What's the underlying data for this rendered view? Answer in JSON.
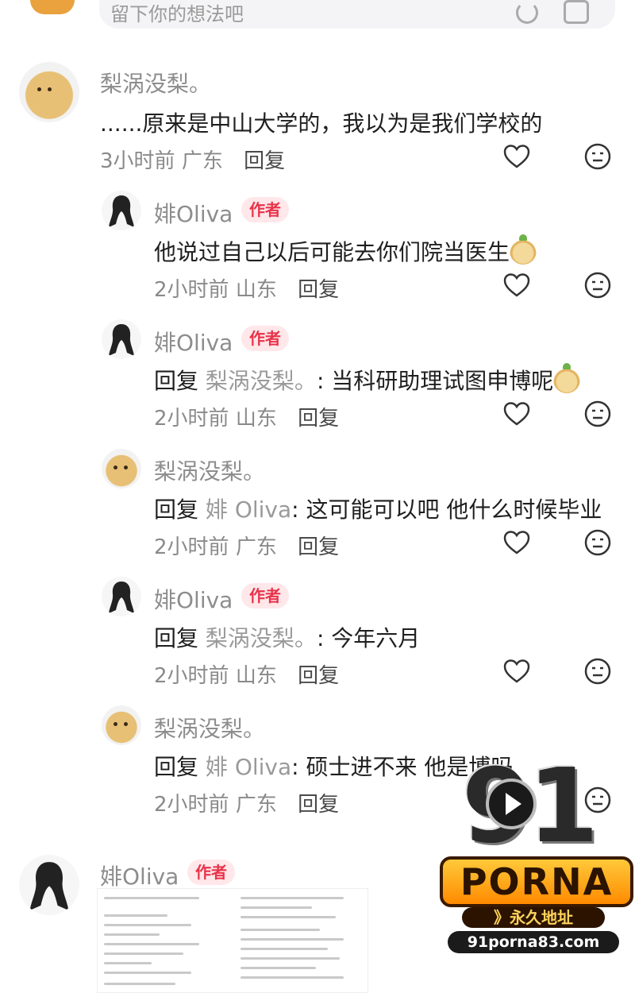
{
  "top_input": {
    "placeholder": "留下你的想法吧"
  },
  "comments": [
    {
      "id": "c1",
      "author": "梨涡没梨。",
      "text": "......原来是中山大学的，我以为是我们学校的",
      "time": "3小时前",
      "region": "广东",
      "reply_label": "回复",
      "avatar": "potato-avatar"
    },
    {
      "id": "r1",
      "author": "婔Oliva",
      "badge": "作者",
      "text": "他说过自己以后可能去你们院当医生",
      "emoji": "pear-emoji",
      "time": "2小时前",
      "region": "山东",
      "reply_label": "回复",
      "avatar": "girl-avatar"
    },
    {
      "id": "r2",
      "author": "婔Oliva",
      "badge": "作者",
      "reply_prefix": "回复",
      "reply_to": "梨涡没梨。",
      "text": ": 当科研助理试图申博呢",
      "emoji": "pear-emoji",
      "time": "2小时前",
      "region": "山东",
      "reply_label": "回复",
      "avatar": "girl-avatar"
    },
    {
      "id": "r3",
      "author": "梨涡没梨。",
      "reply_prefix": "回复",
      "reply_to": "婔 Oliva",
      "text": ": 这可能可以吧  他什么时候毕业",
      "time": "2小时前",
      "region": "广东",
      "reply_label": "回复",
      "avatar": "potato-avatar"
    },
    {
      "id": "r4",
      "author": "婔Oliva",
      "badge": "作者",
      "reply_prefix": "回复",
      "reply_to": "梨涡没梨。",
      "text": ": 今年六月",
      "time": "2小时前",
      "region": "山东",
      "reply_label": "回复",
      "avatar": "girl-avatar"
    },
    {
      "id": "r5",
      "author": "梨涡没梨。",
      "reply_prefix": "回复",
      "reply_to": "婔 Oliva",
      "text": ": 硕士进不来 他是博吗",
      "time": "2小时前",
      "region": "广东",
      "reply_label": "回复",
      "avatar": "potato-avatar"
    },
    {
      "id": "c2",
      "author": "婔Oliva",
      "badge": "作者",
      "avatar": "girl-avatar",
      "attachment": "screenshot-image"
    }
  ],
  "watermark": {
    "logo_number": "91",
    "brand": "PORNA",
    "tagline": "》永久地址",
    "url": "91porna83.com"
  },
  "colors": {
    "author_badge_bg": "#ffe7ea",
    "author_badge_text": "#e8334a",
    "muted_text": "#8d8d8d",
    "body_text": "#1f1f1f"
  }
}
